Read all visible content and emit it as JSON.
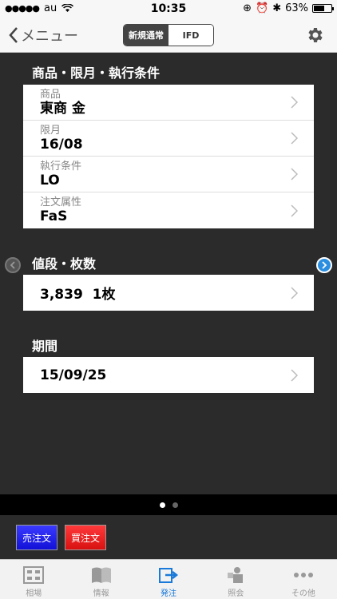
{
  "status_bar": {
    "carrier": "au",
    "time": "10:35",
    "battery": "63%"
  },
  "nav": {
    "back_label": "メニュー",
    "segments": [
      "新規通常",
      "IFD"
    ],
    "active_segment": 0
  },
  "sections": {
    "product": {
      "title": "商品・限月・執行条件",
      "rows": [
        {
          "label": "商品",
          "value": "東商 金"
        },
        {
          "label": "限月",
          "value": "16/08"
        },
        {
          "label": "執行条件",
          "value": "LO"
        },
        {
          "label": "注文属性",
          "value": "FaS"
        }
      ]
    },
    "price": {
      "title": "値段・枚数",
      "value": "3,839  1枚"
    },
    "period": {
      "title": "期間",
      "value": "15/09/25"
    }
  },
  "pager": {
    "pages": 2,
    "current": 1
  },
  "actions": {
    "sell_label": "売注文",
    "buy_label": "買注文"
  },
  "tabs": [
    {
      "label": "相場",
      "icon": "quote-board-icon"
    },
    {
      "label": "情報",
      "icon": "book-icon"
    },
    {
      "label": "発注",
      "icon": "order-icon"
    },
    {
      "label": "照会",
      "icon": "inquiry-icon"
    },
    {
      "label": "その他",
      "icon": "more-icon"
    }
  ],
  "colors": {
    "active_tab": "#1a7ad9",
    "sell": "#1010d8",
    "buy": "#d81010"
  }
}
